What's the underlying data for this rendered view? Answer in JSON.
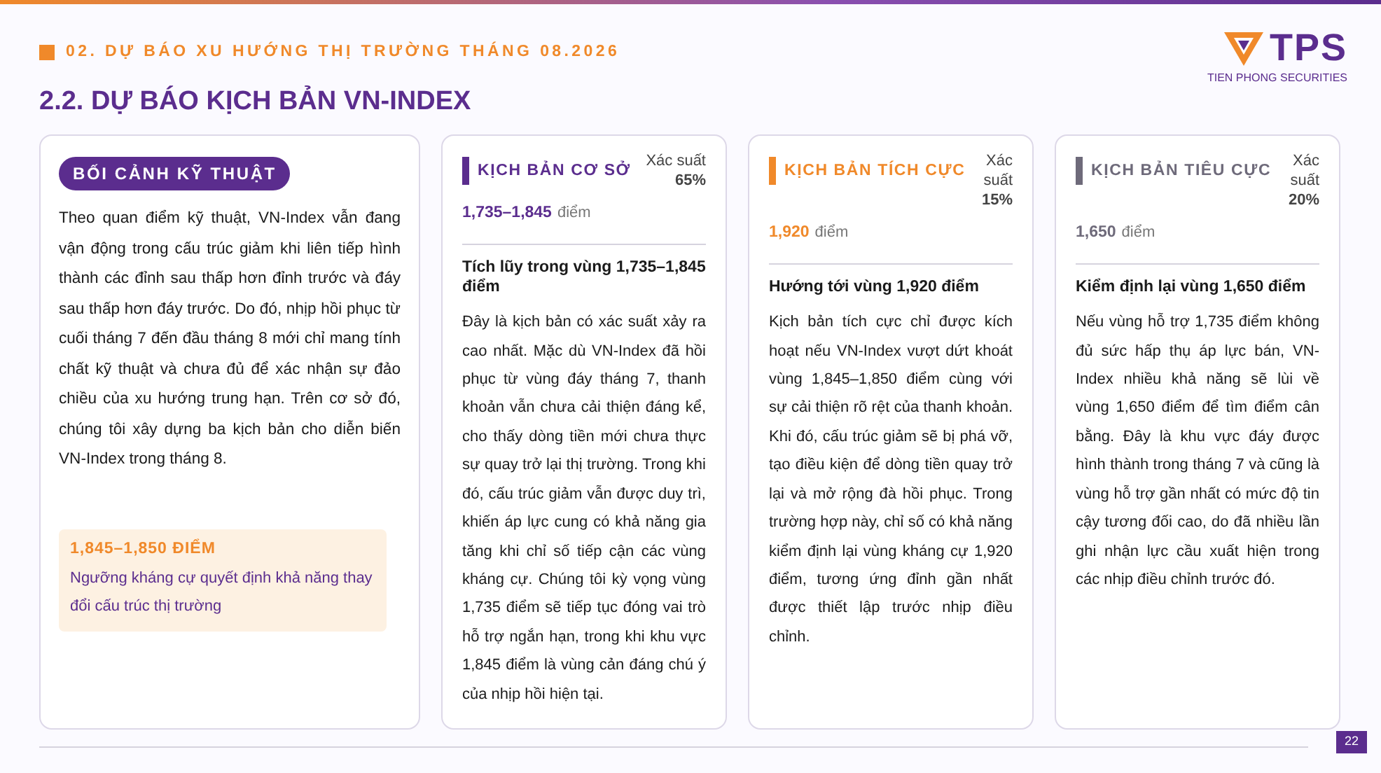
{
  "header": {
    "section_title": "02. DỰ BÁO XU HƯỚNG THỊ TRƯỜNG THÁNG 08.2026",
    "logo_text": "TPS",
    "logo_subtitle": "TIEN PHONG SECURITIES"
  },
  "page_title": "2.2. DỰ BÁO KỊCH BẢN VN-INDEX",
  "context": {
    "badge": "BỐI CẢNH KỸ THUẬT",
    "text": "Theo quan điểm kỹ thuật, VN-Index vẫn đang vận động trong cấu trúc giảm khi liên tiếp hình thành các đỉnh sau thấp hơn đỉnh trước và đáy sau thấp hơn đáy trước. Do đó, nhịp hồi phục từ cuối tháng 7 đến đầu tháng 8 mới chỉ mang tính chất kỹ thuật và chưa đủ để xác nhận sự đảo chiều của xu hướng trung hạn. Trên cơ sở đó, chúng tôi xây dựng ba kịch bản cho diễn biến VN-Index trong tháng 8.",
    "highlight": {
      "value": "1,845–1,850 ĐIỂM",
      "text": "Ngưỡng kháng cự quyết định khả năng thay đổi cấu trúc thị trường"
    }
  },
  "scenarios": [
    {
      "title": "KỊCH BẢN CƠ SỞ",
      "color": "#5b2d8e",
      "probability_label": "Xác suất",
      "probability": "65%",
      "range": "1,735–1,845",
      "unit": "điểm",
      "heading": "Tích lũy trong vùng 1,735–1,845 điểm",
      "text": "Đây là kịch bản có xác suất xảy ra cao nhất. Mặc dù VN-Index đã hồi phục từ vùng đáy tháng 7, thanh khoản vẫn chưa cải thiện đáng kể, cho thấy dòng tiền mới chưa thực sự quay trở lại thị trường. Trong khi đó, cấu trúc giảm vẫn được duy trì, khiến áp lực cung có khả năng gia tăng khi chỉ số tiếp cận các vùng kháng cự. Chúng tôi kỳ vọng vùng 1,735 điểm sẽ tiếp tục đóng vai trò hỗ trợ ngắn hạn, trong khi khu vực 1,845 điểm là vùng cản đáng chú ý của nhịp hồi hiện tại."
    },
    {
      "title": "KỊCH BẢN TÍCH CỰC",
      "color": "#f0892a",
      "probability_label": "Xác suất",
      "probability": "15%",
      "range": "1,920",
      "unit": "điểm",
      "heading": "Hướng tới vùng 1,920 điểm",
      "text": "Kịch bản tích cực chỉ được kích hoạt nếu VN-Index vượt dứt khoát vùng 1,845–1,850 điểm cùng với sự cải thiện rõ rệt của thanh khoản. Khi đó, cấu trúc giảm sẽ bị phá vỡ, tạo điều kiện để dòng tiền quay trở lại và mở rộng đà hồi phục. Trong trường hợp này, chỉ số có khả năng kiểm định lại vùng kháng cự 1,920 điểm, tương ứng đỉnh gần nhất được thiết lập trước nhịp điều chỉnh."
    },
    {
      "title": "KỊCH BẢN TIÊU CỰC",
      "color": "#6e6a7a",
      "probability_label": "Xác suất",
      "probability": "20%",
      "range": "1,650",
      "unit": "điểm",
      "heading": "Kiểm định lại vùng 1,650 điểm",
      "text": "Nếu vùng hỗ trợ 1,735 điểm không đủ sức hấp thụ áp lực bán, VN-Index nhiều khả năng sẽ lùi về vùng 1,650 điểm để tìm điểm cân bằng. Đây là khu vực đáy được hình thành trong tháng 7 và cũng là vùng hỗ trợ gần nhất có mức độ tin cậy tương đối cao, do đã nhiều lần ghi nhận lực cầu xuất hiện trong các nhịp điều chỉnh trước đó."
    }
  ],
  "page_number": "22"
}
